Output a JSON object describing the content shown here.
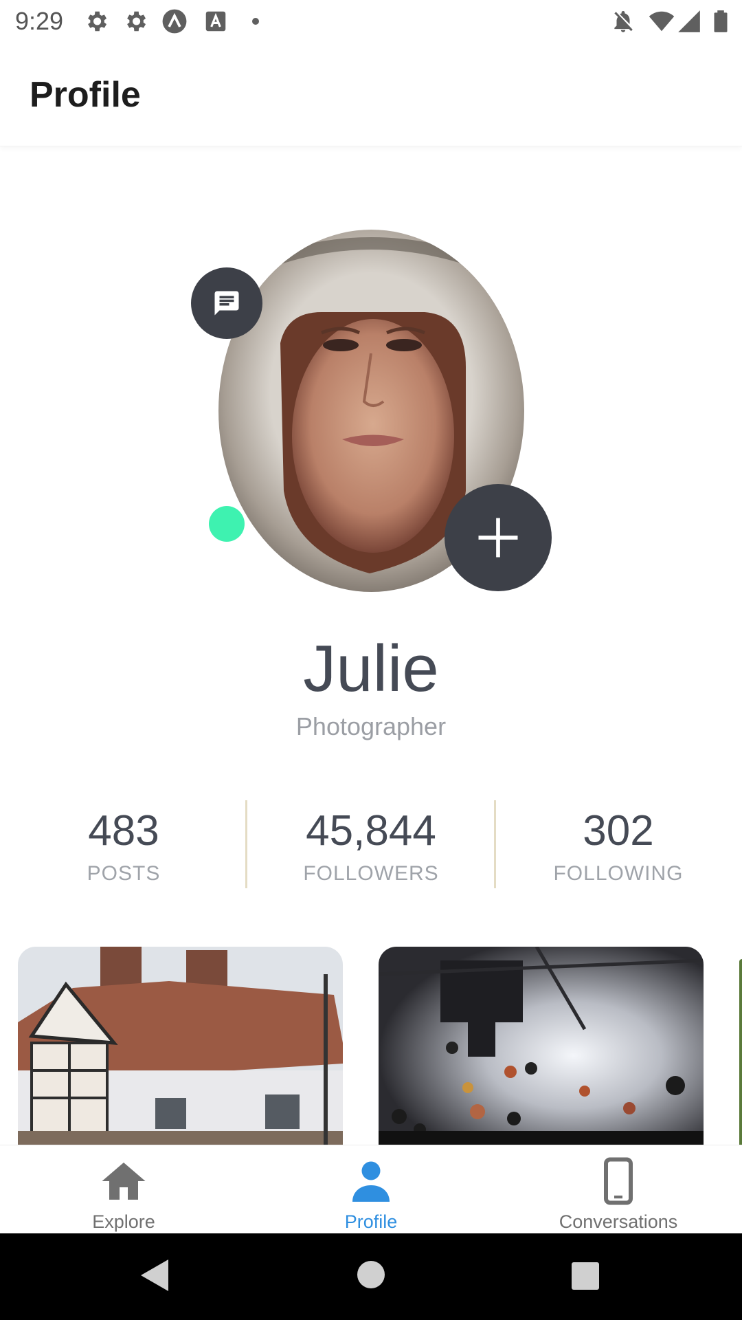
{
  "status_bar": {
    "time": "9:29"
  },
  "app_bar": {
    "title": "Profile"
  },
  "profile": {
    "name": "Julie",
    "role": "Photographer"
  },
  "stats": [
    {
      "value": "483",
      "label": "POSTS"
    },
    {
      "value": "45,844",
      "label": "FOLLOWERS"
    },
    {
      "value": "302",
      "label": "FOLLOWING"
    }
  ],
  "bottom_nav": {
    "items": [
      {
        "label": "Explore",
        "icon": "home-icon",
        "active": false
      },
      {
        "label": "Profile",
        "icon": "person-icon",
        "active": true
      },
      {
        "label": "Conversations",
        "icon": "phone-icon",
        "active": false
      }
    ]
  },
  "colors": {
    "accent": "#2f8fe0",
    "online": "#3ef2b0",
    "fab": "#3d4048",
    "inactive": "#707070"
  }
}
